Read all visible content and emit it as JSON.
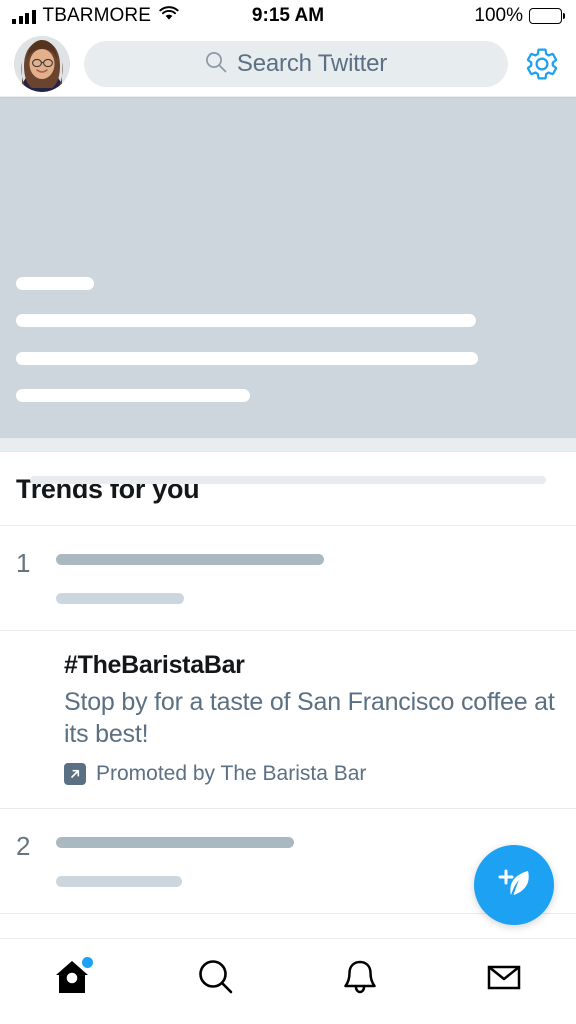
{
  "status_bar": {
    "carrier": "TBARMORE",
    "time": "9:15 AM",
    "battery_percent": "100%",
    "signal_icon": "signal-bars-icon",
    "wifi_icon": "wifi-icon",
    "battery_icon": "battery-full-icon"
  },
  "header": {
    "avatar": "user-avatar",
    "search": {
      "placeholder": "Search Twitter",
      "icon": "search-icon"
    },
    "settings_icon": "gear-icon"
  },
  "banner": {
    "type": "skeleton-placeholder",
    "bar_count": 4
  },
  "trends": {
    "title": "Trends for you",
    "items": [
      {
        "rank": "1",
        "state": "loading"
      },
      {
        "rank": "2",
        "state": "loading"
      }
    ]
  },
  "promoted": {
    "hashtag": "#TheBaristaBar",
    "body": "Stop by for a taste of San Francisco coffee at its best!",
    "promoted_by": "Promoted by The Barista Bar",
    "badge_icon": "external-link-arrow-icon"
  },
  "compose": {
    "icon": "compose-feather-plus-icon",
    "color": "#1da1f2"
  },
  "tabbar": {
    "items": [
      {
        "name": "home",
        "icon": "home-icon",
        "active": true,
        "badge": true
      },
      {
        "name": "search",
        "icon": "search-icon",
        "active": false,
        "badge": false
      },
      {
        "name": "notifications",
        "icon": "bell-icon",
        "active": false,
        "badge": false
      },
      {
        "name": "messages",
        "icon": "envelope-icon",
        "active": false,
        "badge": false
      }
    ]
  },
  "colors": {
    "accent": "#1da1f2",
    "text_primary": "#14171a",
    "text_secondary": "#5b7083",
    "skeleton_dark": "#aab8c2",
    "skeleton_light": "#ccd6dd",
    "banner_bg": "#ced6dd"
  }
}
